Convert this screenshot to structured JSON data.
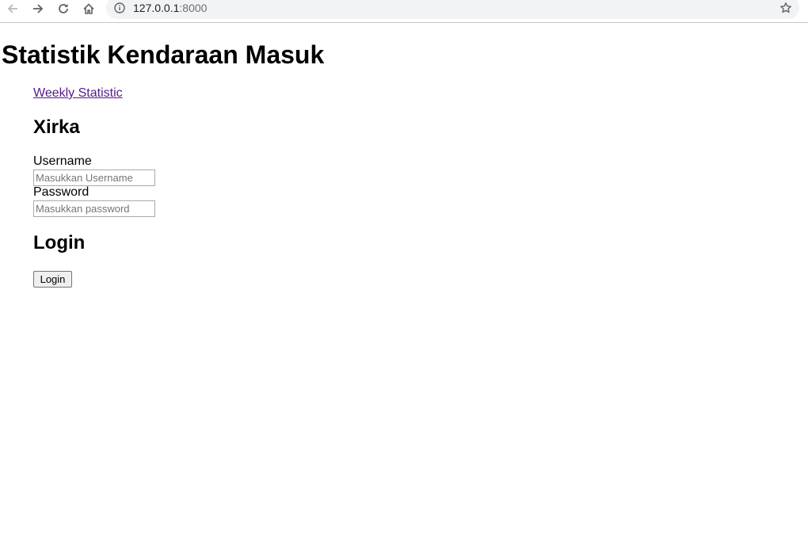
{
  "browser": {
    "url_host": "127.0.0.1",
    "url_port": ":8000",
    "icons": {
      "back": "back-arrow-icon",
      "forward": "forward-arrow-icon",
      "reload": "reload-icon",
      "home": "home-icon",
      "info": "info-icon",
      "bookmark": "star-icon"
    }
  },
  "page": {
    "title": "Statistik Kendaraan Masuk",
    "weekly_link": "Weekly Statistic",
    "brand": "Xirka",
    "username_label": "Username",
    "username_placeholder": "Masukkan Username",
    "password_label": "Password",
    "password_placeholder": "Masukkan password",
    "login_heading": "Login",
    "login_button": "Login"
  },
  "colors": {
    "link_visited": "#551a8b",
    "omnibox_bg": "#f1f3f4"
  }
}
